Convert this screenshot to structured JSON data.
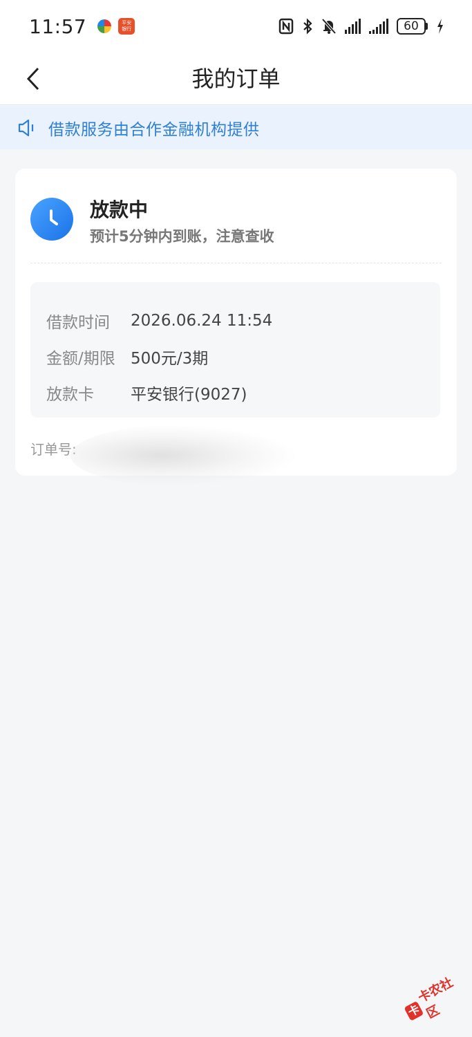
{
  "status_bar": {
    "time": "11:57",
    "app_badge_line1": "平安",
    "app_badge_line2": "银行",
    "battery": "60"
  },
  "nav": {
    "title": "我的订单"
  },
  "notice": {
    "text": "借款服务由合作金融机构提供"
  },
  "order": {
    "status_title": "放款中",
    "status_desc": "预计5分钟内到账，注意查收",
    "rows": [
      {
        "label": "借款时间",
        "value": "2026.06.24 11:54"
      },
      {
        "label": "金额/期限",
        "value": "500元/3期"
      },
      {
        "label": "放款卡",
        "value": "平安银行(9027)"
      }
    ],
    "order_no_label": "订单号:"
  },
  "watermark": {
    "mark": "卡",
    "text": "卡农社区"
  },
  "colors": {
    "accent": "#2f7fd3",
    "status_icon": "#1a73e8",
    "notice_bg": "#eaf2fd"
  }
}
